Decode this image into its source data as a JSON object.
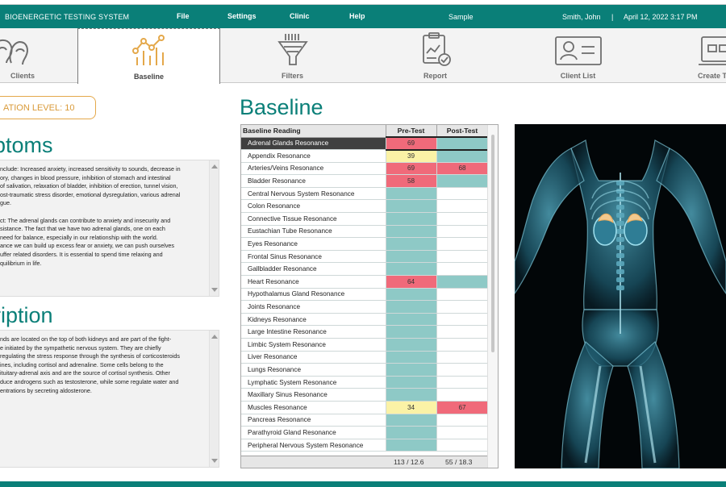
{
  "header": {
    "app_title": "BIOENERGETIC TESTING SYSTEM",
    "menu": [
      "File",
      "Settings",
      "Clinic",
      "Help"
    ],
    "sample": "Sample",
    "user": "Smith, John",
    "separator": "|",
    "datetime": "April 12, 2022  3:17 PM"
  },
  "tabs": [
    {
      "label": "Clients",
      "icon": "clients-icon"
    },
    {
      "label": "Baseline",
      "icon": "baseline-chart-icon",
      "active": true
    },
    {
      "label": "Filters",
      "icon": "filter-funnel-icon"
    },
    {
      "label": "Report",
      "icon": "report-icon"
    },
    {
      "label": "Client List",
      "icon": "client-list-icon"
    },
    {
      "label": "Create T",
      "icon": "create-test-icon"
    }
  ],
  "left": {
    "level": "ATION LEVEL: 10",
    "symptoms_title": "ptoms",
    "symptoms_text": "nclude: Increased anxiety, increased sensitivity to sounds, decrease in\nory, changes in blood pressure, inhibition of stomach and intestinal\nof salivation, relaxation of bladder, inhibition of erection, tunnel vision,\nost-traumatic stress disorder, emotional dysregulation, various adrenal\ngue.\n\nct: The adrenal glands can contribute to anxiety and insecurity and\nsistance.  The fact that we have two adrenal glands, one on each\nneed for balance, especially in our relationship with the world.\nance we can build up excess fear or anxiety, we can push ourselves\nuffer related disorders.  It is essential to spend time relaxing and\nquilibrium in life.",
    "description_title": "ription",
    "description_text": "nds are located on the top of both kidneys and are part of the fight-\ne initiated by the sympathetic nervous system.  They are chiefly\nregulating the stress response through the synthesis of corticosteroids\nines, including cortisol and adrenaline.  Some cells belong to the\nituitary-adrenal axis and are the source of cortisol synthesis. Other\nduce androgens such as testosterone, while some regulate water and\nentrations by secreting aldosterone."
  },
  "baseline": {
    "title": "Baseline",
    "columns": [
      "Baseline Reading",
      "Pre-Test",
      "Post-Test"
    ],
    "rows": [
      {
        "name": "Adrenal Glands Resonance",
        "pre": "69",
        "pre_status": "red",
        "post": "",
        "post_status": "teal"
      },
      {
        "name": "Appendix Resonance",
        "pre": "39",
        "pre_status": "yellow",
        "post": "",
        "post_status": "teal"
      },
      {
        "name": "Arteries/Veins Resonance",
        "pre": "69",
        "pre_status": "red",
        "post": "68",
        "post_status": "red"
      },
      {
        "name": "Bladder Resonance",
        "pre": "58",
        "pre_status": "red",
        "post": "",
        "post_status": "teal"
      },
      {
        "name": "Central Nervous System  Resonance",
        "pre": "",
        "pre_status": "teal",
        "post": "",
        "post_status": "white"
      },
      {
        "name": "Colon Resonance",
        "pre": "",
        "pre_status": "teal",
        "post": "",
        "post_status": "white"
      },
      {
        "name": "Connective Tissue Resonance",
        "pre": "",
        "pre_status": "teal",
        "post": "",
        "post_status": "white"
      },
      {
        "name": "Eustachian Tube Resonance",
        "pre": "",
        "pre_status": "teal",
        "post": "",
        "post_status": "white"
      },
      {
        "name": "Eyes Resonance",
        "pre": "",
        "pre_status": "teal",
        "post": "",
        "post_status": "white"
      },
      {
        "name": "Frontal Sinus Resonance",
        "pre": "",
        "pre_status": "teal",
        "post": "",
        "post_status": "white"
      },
      {
        "name": "Gallbladder Resonance",
        "pre": "",
        "pre_status": "teal",
        "post": "",
        "post_status": "white"
      },
      {
        "name": "Heart Resonance",
        "pre": "64",
        "pre_status": "red",
        "post": "",
        "post_status": "teal"
      },
      {
        "name": "Hypothalamus Gland Resonance",
        "pre": "",
        "pre_status": "teal",
        "post": "",
        "post_status": "white"
      },
      {
        "name": "Joints Resonance",
        "pre": "",
        "pre_status": "teal",
        "post": "",
        "post_status": "white"
      },
      {
        "name": "Kidneys Resonance",
        "pre": "",
        "pre_status": "teal",
        "post": "",
        "post_status": "white"
      },
      {
        "name": "Large Intestine Resonance",
        "pre": "",
        "pre_status": "teal",
        "post": "",
        "post_status": "white"
      },
      {
        "name": "Limbic System Resonance",
        "pre": "",
        "pre_status": "teal",
        "post": "",
        "post_status": "white"
      },
      {
        "name": "Liver Resonance",
        "pre": "",
        "pre_status": "teal",
        "post": "",
        "post_status": "white"
      },
      {
        "name": "Lungs Resonance",
        "pre": "",
        "pre_status": "teal",
        "post": "",
        "post_status": "white"
      },
      {
        "name": "Lymphatic System Resonance",
        "pre": "",
        "pre_status": "teal",
        "post": "",
        "post_status": "white"
      },
      {
        "name": "Maxillary Sinus Resonance",
        "pre": "",
        "pre_status": "teal",
        "post": "",
        "post_status": "white"
      },
      {
        "name": "Muscles Resonance",
        "pre": "34",
        "pre_status": "yellow",
        "post": "67",
        "post_status": "red"
      },
      {
        "name": "Pancreas Resonance",
        "pre": "",
        "pre_status": "teal",
        "post": "",
        "post_status": "white"
      },
      {
        "name": "Parathyroid Gland Resonance",
        "pre": "",
        "pre_status": "teal",
        "post": "",
        "post_status": "white"
      },
      {
        "name": "Peripheral Nervous System Resonance",
        "pre": "",
        "pre_status": "teal",
        "post": "",
        "post_status": "white"
      }
    ],
    "footer_pre": "113 / 12.6",
    "footer_post": "55 / 18.3",
    "selected_row": 0
  },
  "colors": {
    "accent": "#0a7f78",
    "red": "#f06a7a",
    "yellow": "#fbf2a6",
    "teal": "#8ec9c6",
    "white": "#ffffff",
    "orange": "#e4a84a"
  }
}
